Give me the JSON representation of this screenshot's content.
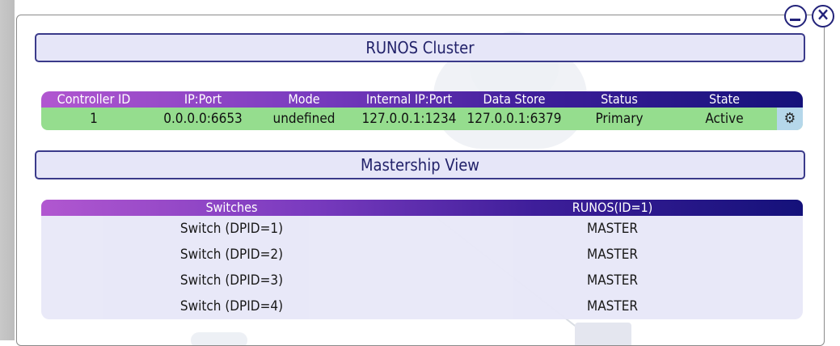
{
  "window": {
    "minimize_label": "minimize",
    "close_label": "close"
  },
  "cluster": {
    "title": "RUNOS Cluster",
    "columns": [
      "Controller ID",
      "IP:Port",
      "Mode",
      "Internal IP:Port",
      "Data Store",
      "Status",
      "State"
    ],
    "rows": [
      [
        "1",
        "0.0.0.0:6653",
        "undefined",
        "127.0.0.1:1234",
        "127.0.0.1:6379",
        "Primary",
        "Active"
      ]
    ],
    "row_color": "#95dd8e",
    "settings_icon": "gear-icon"
  },
  "mastership": {
    "title": "Mastership View",
    "columns": [
      "Switches",
      "RUNOS(ID=1)"
    ],
    "rows": [
      [
        "Switch (DPID=1)",
        "MASTER"
      ],
      [
        "Switch (DPID=2)",
        "MASTER"
      ],
      [
        "Switch (DPID=3)",
        "MASTER"
      ],
      [
        "Switch (DPID=4)",
        "MASTER"
      ]
    ]
  },
  "colors": {
    "header_gradient_start": "#b157d0",
    "header_gradient_end": "#14117a",
    "title_border": "#3a3a8a",
    "title_bg": "#e6e6f8"
  }
}
